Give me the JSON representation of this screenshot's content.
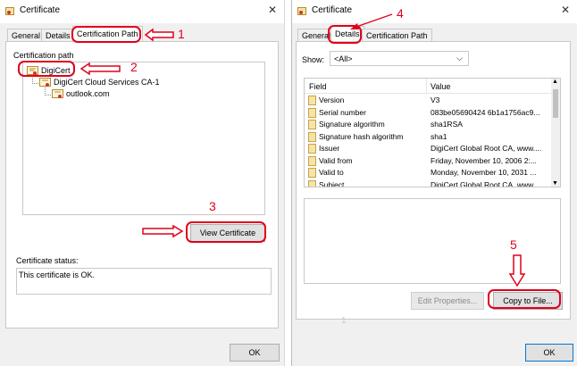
{
  "left_window": {
    "title": "Certificate",
    "tabs": [
      "General",
      "Details",
      "Certification Path"
    ],
    "cert_path_label": "Certification path",
    "tree": [
      "DigiCert",
      "DigiCert Cloud Services CA-1",
      "outlook.com"
    ],
    "view_cert_button": "View Certificate",
    "status_label": "Certificate status:",
    "status_text": "This certificate is OK.",
    "ok_button": "OK"
  },
  "right_window": {
    "title": "Certificate",
    "tabs": [
      "General",
      "Details",
      "Certification Path"
    ],
    "show_label": "Show:",
    "show_value": "<All>",
    "columns": [
      "Field",
      "Value"
    ],
    "rows": [
      {
        "field": "Version",
        "value": "V3"
      },
      {
        "field": "Serial number",
        "value": "083be05690424 6b1a1756ac9..."
      },
      {
        "field": "Signature algorithm",
        "value": "sha1RSA"
      },
      {
        "field": "Signature hash algorithm",
        "value": "sha1"
      },
      {
        "field": "Issuer",
        "value": "DigiCert Global Root CA, www...."
      },
      {
        "field": "Valid from",
        "value": "Friday, November 10, 2006 2:..."
      },
      {
        "field": "Valid to",
        "value": "Monday, November 10, 2031 ..."
      },
      {
        "field": "Subject",
        "value": "DigiCert Global Root CA, www..."
      }
    ],
    "edit_properties_button": "Edit Properties...",
    "copy_to_file_button": "Copy to File...",
    "ok_button": "OK",
    "stray_mark": "1"
  },
  "annotations": {
    "step1": "1",
    "step2": "2",
    "step3": "3",
    "step4": "4",
    "step5": "5",
    "color": "#e0001b"
  }
}
